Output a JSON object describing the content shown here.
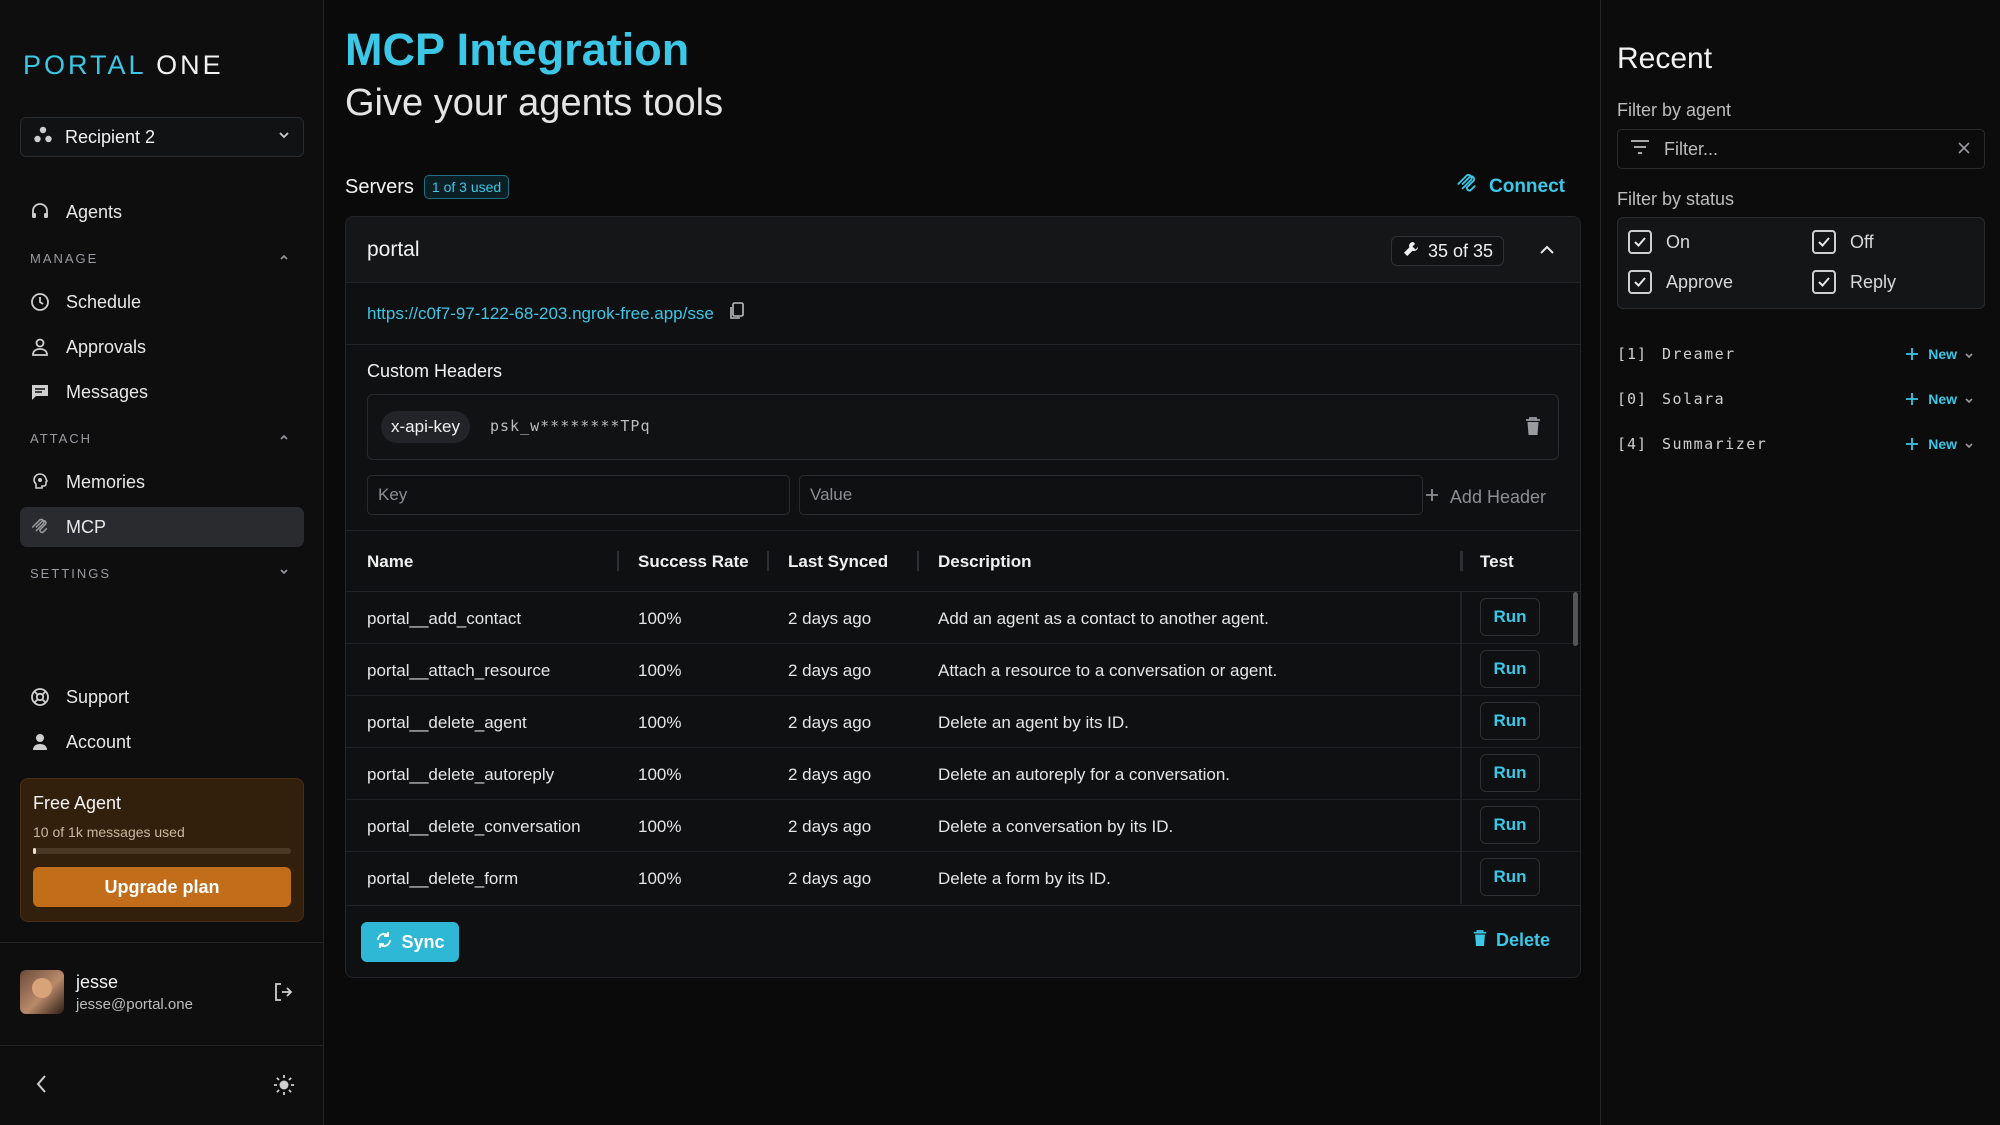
{
  "sidebar": {
    "logo": {
      "part1": "PORTAL",
      "part2": "ONE"
    },
    "workspace": "Recipient 2",
    "nav": {
      "agents": "Agents",
      "manage_head": "MANAGE",
      "schedule": "Schedule",
      "approvals": "Approvals",
      "messages": "Messages",
      "attach_head": "ATTACH",
      "memories": "Memories",
      "mcp": "MCP",
      "settings_head": "SETTINGS",
      "support": "Support",
      "account": "Account"
    },
    "plan": {
      "title": "Free Agent",
      "usage": "10 of 1k messages used",
      "progress": 0.01,
      "upgrade": "Upgrade plan"
    },
    "user": {
      "name": "jesse",
      "email": "jesse@portal.one"
    }
  },
  "main": {
    "title": "MCP Integration",
    "subtitle": "Give your agents tools",
    "servers_label": "Servers",
    "servers_badge": "1 of 3 used",
    "connect": "Connect",
    "server": {
      "name": "portal",
      "tools_count": "35 of 35",
      "url": "https://c0f7-97-122-68-203.ngrok-free.app/sse",
      "custom_headers_label": "Custom Headers",
      "header_key": "x-api-key",
      "header_value": "psk_w********TPq",
      "key_placeholder": "Key",
      "value_placeholder": "Value",
      "add_header": "Add Header",
      "columns": {
        "name": "Name",
        "success": "Success Rate",
        "synced": "Last Synced",
        "description": "Description",
        "test": "Test"
      },
      "tools": [
        {
          "name": "portal__add_contact",
          "success": "100%",
          "synced": "2 days ago",
          "description": "Add an agent as a contact to another agent.",
          "action": "Run"
        },
        {
          "name": "portal__attach_resource",
          "success": "100%",
          "synced": "2 days ago",
          "description": "Attach a resource to a conversation or agent.",
          "action": "Run"
        },
        {
          "name": "portal__delete_agent",
          "success": "100%",
          "synced": "2 days ago",
          "description": "Delete an agent by its ID.",
          "action": "Run"
        },
        {
          "name": "portal__delete_autoreply",
          "success": "100%",
          "synced": "2 days ago",
          "description": "Delete an autoreply for a conversation.",
          "action": "Run"
        },
        {
          "name": "portal__delete_conversation",
          "success": "100%",
          "synced": "2 days ago",
          "description": "Delete a conversation by its ID.",
          "action": "Run"
        },
        {
          "name": "portal__delete_form",
          "success": "100%",
          "synced": "2 days ago",
          "description": "Delete a form by its ID.",
          "action": "Run"
        }
      ],
      "sync": "Sync",
      "delete": "Delete"
    }
  },
  "recent": {
    "title": "Recent",
    "filter_agent_label": "Filter by agent",
    "filter_placeholder": "Filter...",
    "filter_status_label": "Filter by status",
    "statuses": {
      "on": "On",
      "off": "Off",
      "approve": "Approve",
      "reply": "Reply"
    },
    "agents": [
      {
        "idx": "[1]",
        "name": "Dreamer",
        "new": "New"
      },
      {
        "idx": "[0]",
        "name": "Solara",
        "new": "New"
      },
      {
        "idx": "[4]",
        "name": "Summarizer",
        "new": "New"
      }
    ]
  },
  "colors": {
    "accent": "#3cc7e6",
    "upgrade": "#c26d1a",
    "plan_bg": "#33200c"
  }
}
